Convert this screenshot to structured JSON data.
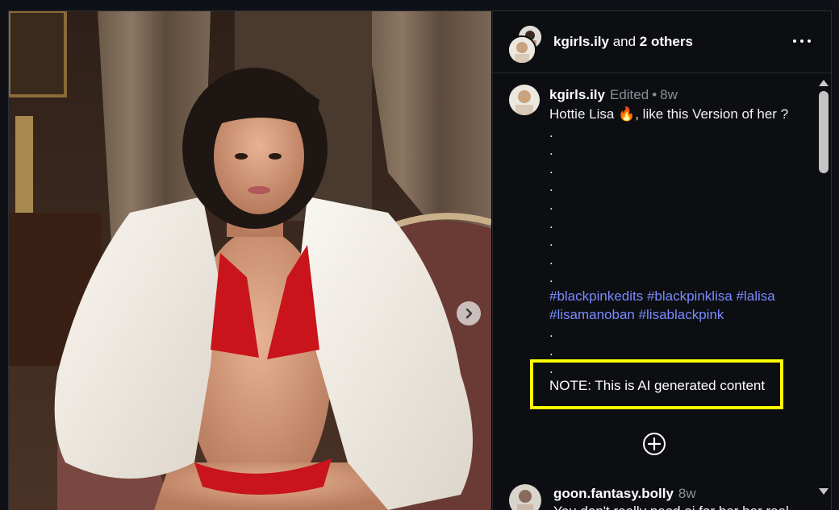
{
  "header": {
    "username": "kgirls.ily",
    "and_text": " and ",
    "others": "2 others",
    "more_icon": "more-horizontal-icon"
  },
  "caption": {
    "username": "kgirls.ily",
    "edited": "Edited",
    "separator": "•",
    "time": "8w",
    "first_line_a": "Hottie Lisa ",
    "emoji": "🔥",
    "first_line_b": ", like this Version of her ?",
    "dots_top": [
      ".",
      ".",
      ".",
      ".",
      ".",
      ".",
      ".",
      ".",
      "."
    ],
    "hashtags_line1": "#blackpinkedits #blackpinklisa #lalisa",
    "hashtags_line2": "#lisamanoban #lisablackpink",
    "dots_bottom": [
      ".",
      ".",
      "."
    ],
    "note": "NOTE: This is AI generated content"
  },
  "load_more_icon": "plus-circle-icon",
  "comment": {
    "username": "goon.fantasy.bolly",
    "time": "8w",
    "text": "You don't really need ai for her her real"
  },
  "media": {
    "next_icon": "chevron-right-icon"
  },
  "colors": {
    "hashtag": "#7b8cff",
    "highlight_box": "#ffff00",
    "panel_bg": "#0c0e12"
  }
}
